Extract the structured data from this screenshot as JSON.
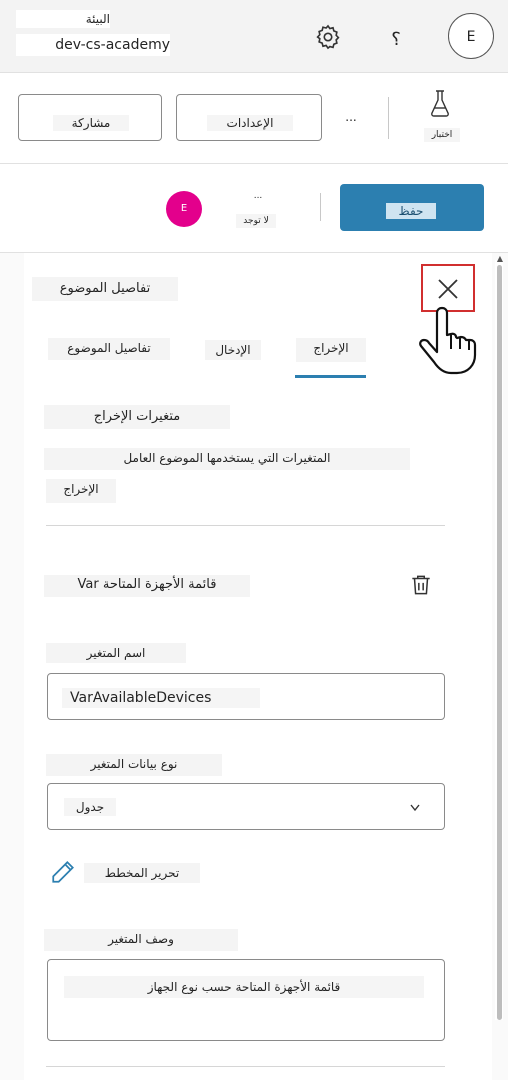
{
  "header": {
    "env_label": "البيئة",
    "env_name": "dev-cs-academy",
    "help": "؟",
    "avatar": "E"
  },
  "toolbar": {
    "test_label": "اختبار",
    "more": "...",
    "settings_label": "الإعدادات",
    "share_label": "مشاركة"
  },
  "bar2": {
    "publish_label": "حفظ",
    "status_dots": "...",
    "status_text": "لا توجد",
    "avatar": "E"
  },
  "panel": {
    "title": "تفاصيل الموضوع",
    "tabs": [
      {
        "label": "الإخراج"
      },
      {
        "label": "الإدخال"
      },
      {
        "label": "تفاصيل الموضوع"
      }
    ],
    "output_vars_heading": "متغيرات الإخراج",
    "output_vars_desc": "المتغيرات التي يستخدمها الموضوع العامل",
    "output_label": "الإخراج",
    "var_card_title": "قائمة الأجهزة المتاحة Var",
    "var_name_label": "اسم المتغير",
    "var_name_value": "VarAvailableDevices",
    "var_type_label": "نوع بيانات المتغير",
    "var_type_value": "جدول",
    "edit_schema_label": "تحرير المخطط",
    "var_desc_label": "وصف المتغير",
    "var_desc_value": "قائمة الأجهزة المتاحة حسب نوع الجهاز"
  },
  "colors": {
    "accent": "#2c7fb0",
    "avatar_pink": "#e3008c",
    "highlight_red": "#d12f2f"
  }
}
